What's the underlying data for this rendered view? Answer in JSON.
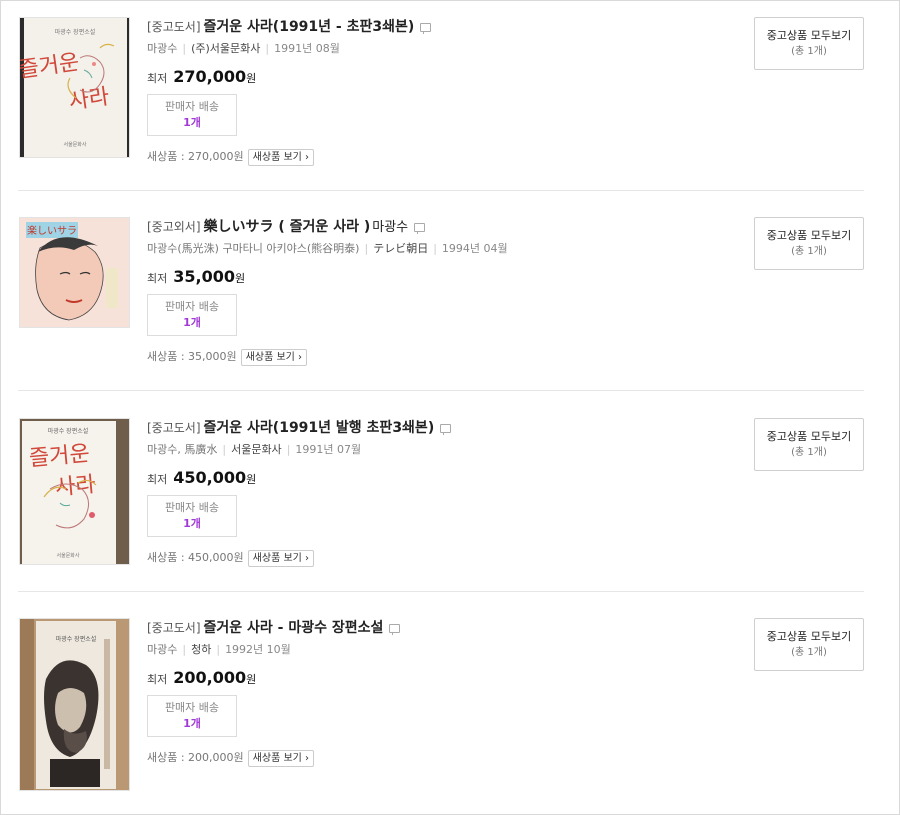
{
  "items": [
    {
      "category": "[중고도서]",
      "title": "즐거운 사라(1991년 - 초판3쇄본)",
      "subtitle": "",
      "author": "마광수",
      "publisher": "(주)서울문화사",
      "date": "1991년 08월",
      "lowest_label": "최저",
      "price": "270,000",
      "won": "원",
      "ship_label": "판매자 배송",
      "ship_count": "1개",
      "new_price": "새상품 : 270,000원",
      "new_btn": "새상품 보기 ›",
      "all_btn": "중고상품 모두보기",
      "all_count": "(총 1개)",
      "cover_top": "마광수 장편소설",
      "cover_title_a": "즐거운",
      "cover_title_b": "사라",
      "cover_note": "서울문화사"
    },
    {
      "category": "[중고외서]",
      "title": "樂しいサラ ( 즐거운 사라 )",
      "subtitle": "마광수",
      "author": "마광수(馬光洙) 구마타니 아키야스(熊谷明泰)",
      "publisher": "テレビ朝日",
      "date": "1994년 04월",
      "lowest_label": "최저",
      "price": "35,000",
      "won": "원",
      "ship_label": "판매자 배송",
      "ship_count": "1개",
      "new_price": "새상품 : 35,000원",
      "new_btn": "새상품 보기 ›",
      "all_btn": "중고상품 모두보기",
      "all_count": "(총 1개)",
      "cover_title_a": "楽しいサラ"
    },
    {
      "category": "[중고도서]",
      "title": "즐거운 사라(1991년 발행 초판3쇄본)",
      "subtitle": "",
      "author": "마광수, 馬廣水",
      "publisher": "서울문화사",
      "date": "1991년 07월",
      "lowest_label": "최저",
      "price": "450,000",
      "won": "원",
      "ship_label": "판매자 배송",
      "ship_count": "1개",
      "new_price": "새상품 : 450,000원",
      "new_btn": "새상품 보기 ›",
      "all_btn": "중고상품 모두보기",
      "all_count": "(총 1개)",
      "cover_top": "마광수 장편소설",
      "cover_title_a": "즐거운",
      "cover_title_b": "사라",
      "cover_note": "서울문화사"
    },
    {
      "category": "[중고도서]",
      "title": "즐거운 사라 - 마광수 장편소설",
      "subtitle": "",
      "author": "마광수",
      "publisher": "청하",
      "date": "1992년 10월",
      "lowest_label": "최저",
      "price": "200,000",
      "won": "원",
      "ship_label": "판매자 배송",
      "ship_count": "1개",
      "new_price": "새상품 : 200,000원",
      "new_btn": "새상품 보기 ›",
      "all_btn": "중고상품 모두보기",
      "all_count": "(총 1개)",
      "cover_top": "마광수 장편소설"
    }
  ],
  "colors": {
    "ship_count": "#a23bd6",
    "price": "#111111",
    "divider": "#e6e6e6"
  }
}
